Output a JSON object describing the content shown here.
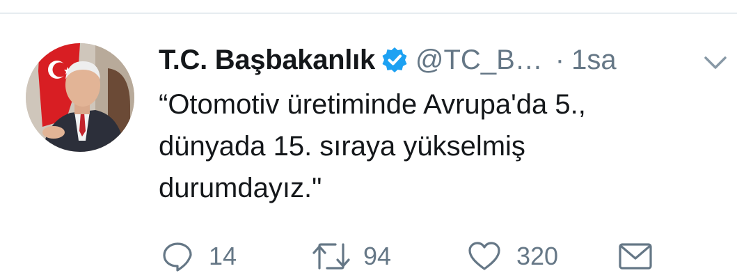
{
  "tweet": {
    "display_name": "T.C. Başbakanlık",
    "handle": "@TC_B…",
    "separator": "·",
    "time": "1sa",
    "verified": true,
    "text_lines": [
      "“Otomotiv üretiminde Avrupa'da 5.,",
      "dünyada 15. sıraya yükselmiş",
      "durumdayız.\""
    ]
  },
  "actions": {
    "reply_count": "14",
    "retweet_count": "94",
    "like_count": "320"
  },
  "icons": {
    "verified": "verified-badge-icon",
    "caret": "chevron-down-icon",
    "reply": "reply-icon",
    "retweet": "retweet-icon",
    "like": "heart-icon",
    "dm": "envelope-icon"
  },
  "colors": {
    "primary_text": "#14171a",
    "secondary_text": "#657786",
    "verified_blue": "#1da1f2",
    "divider": "#e6ecf0"
  }
}
